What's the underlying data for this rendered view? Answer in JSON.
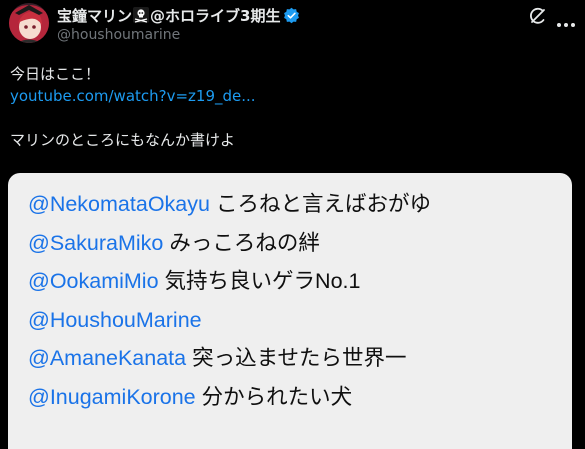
{
  "author": {
    "display_name_part1": "宝鐘マリン",
    "display_name_part2": "@ホロライブ3期生",
    "emoji_icon": "skull-and-crossbones-icon",
    "verified_icon": "verified-badge-icon",
    "handle": "@houshoumarine"
  },
  "post": {
    "line1": "今日はここ！",
    "link": "youtube.com/watch?v=z19_de...",
    "line3": "マリンのところにもなんか書けよ"
  },
  "card": {
    "rows": [
      {
        "mention": "@NekomataOkayu",
        "text": "ころねと言えばおがゆ"
      },
      {
        "mention": "@SakuraMiko",
        "text": "みっころねの絆"
      },
      {
        "mention": "@OokamiMio",
        "text": "気持ち良いゲラNo.1"
      },
      {
        "mention": "@HoushouMarine",
        "text": ""
      },
      {
        "mention": "@AmaneKanata",
        "text": "突っ込ませたら世界一"
      },
      {
        "mention": "@InugamiKorone",
        "text": "分かられたい犬"
      }
    ]
  },
  "icons": {
    "grok": "grok-icon",
    "more": "more-options-icon"
  },
  "colors": {
    "background": "#000000",
    "text": "#e7e9ea",
    "secondary": "#71767b",
    "link": "#1d9bf0",
    "verified": "#1d9bf0",
    "card_background": "#efefef",
    "card_mention": "#1a73e8",
    "card_text": "#0f0f0f"
  }
}
